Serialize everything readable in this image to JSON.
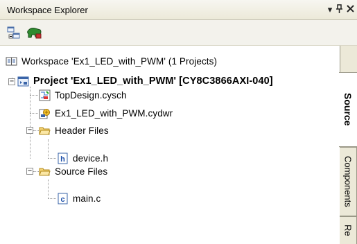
{
  "panel": {
    "title": "Workspace Explorer",
    "pin_glyph": "▾",
    "autohide_glyph": "ᵖ",
    "close_glyph": "✕"
  },
  "toolbar": {
    "buttons": [
      {
        "icon": "collapse-all-icon"
      },
      {
        "icon": "build-icon"
      }
    ]
  },
  "tree": {
    "workspace": "Workspace 'Ex1_LED_with_PWM' (1 Projects)",
    "project": "Project 'Ex1_LED_with_PWM' [CY8C3866AXI-040]",
    "items": {
      "topdesign": "TopDesign.cysch",
      "cydwr": "Ex1_LED_with_PWM.cydwr",
      "header_folder": "Header Files",
      "device_h": "device.h",
      "source_folder": "Source Files",
      "main_c": "main.c"
    },
    "expander_minus": "−"
  },
  "tabs": [
    {
      "label": "Source",
      "active": true
    },
    {
      "label": "Components",
      "active": false
    },
    {
      "label": "Re",
      "active": false
    }
  ]
}
